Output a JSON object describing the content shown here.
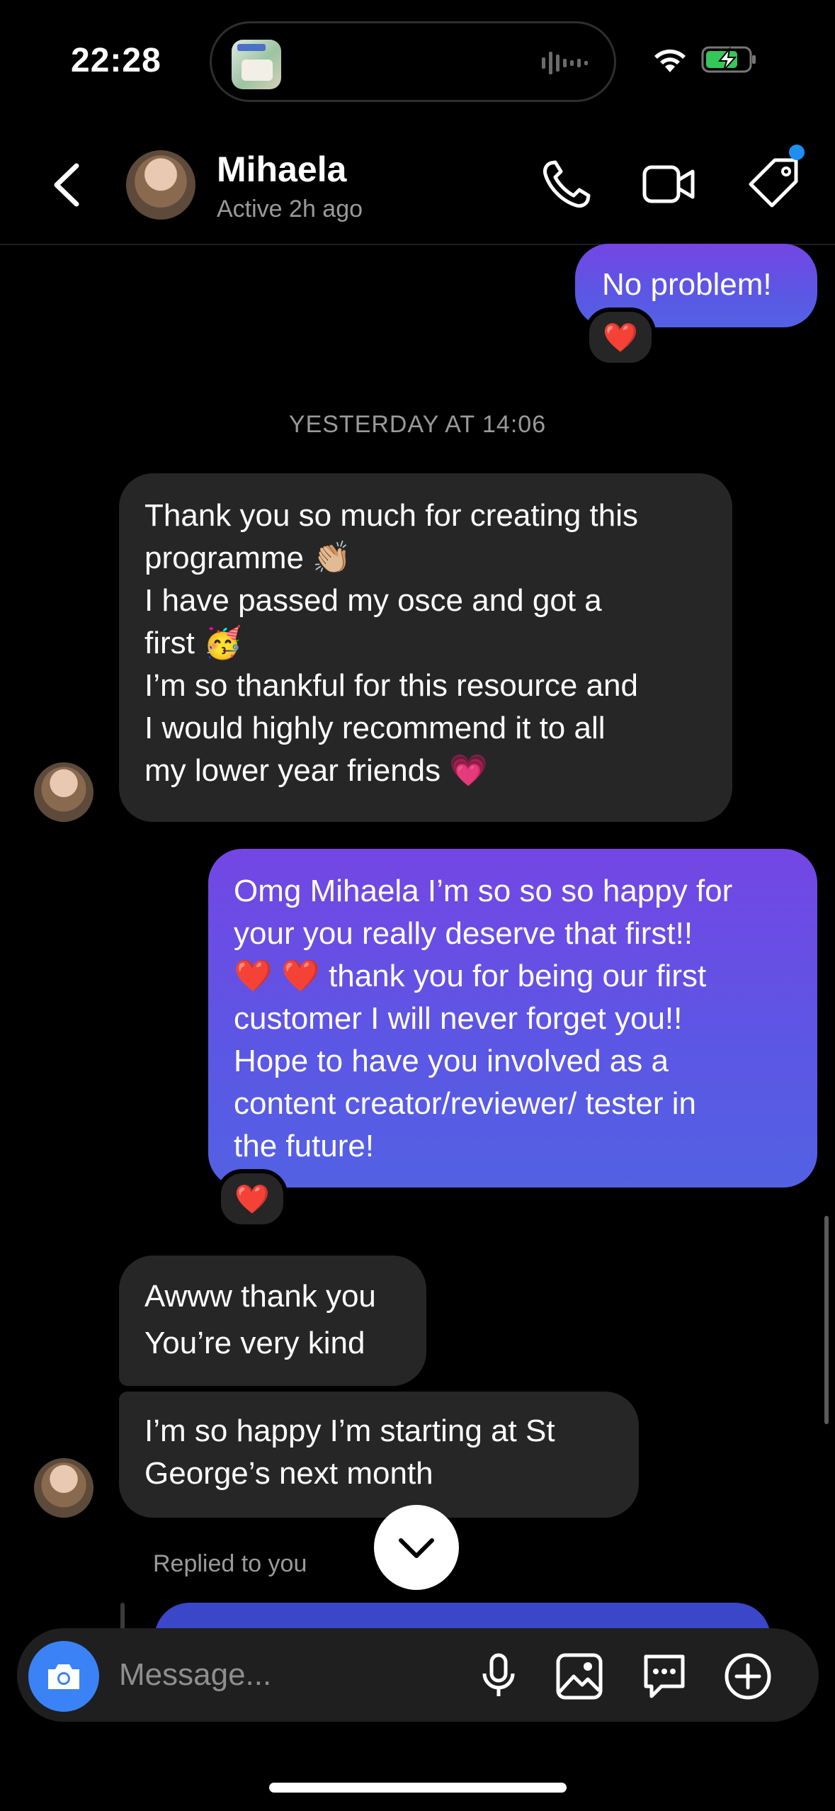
{
  "status_bar": {
    "time": "22:28"
  },
  "header": {
    "name": "Mihaela",
    "status": "Active 2h ago",
    "icons": [
      "back-chevron-icon",
      "phone-icon",
      "video-icon",
      "tag-icon"
    ]
  },
  "messages": {
    "m1": {
      "lines": [
        "No problem!"
      ],
      "reaction": "❤️"
    },
    "day_stamp": "YESTERDAY AT 14:06",
    "m2": {
      "lines": [
        "Thank you so much for creating this",
        "programme 👏🏼",
        "I have passed my osce and got a",
        "first 🥳",
        "I’m so thankful for this resource and",
        "I would highly recommend it to all",
        "my lower year friends 💗"
      ]
    },
    "m3": {
      "lines": [
        "Omg Mihaela I’m so so so happy for",
        "your you really deserve that first!!",
        "❤️ ❤️ thank you for being our first",
        "customer I will never forget you!!",
        "Hope to have you involved as a",
        "content creator/reviewer/ tester in",
        "the future!"
      ],
      "reaction": "❤️"
    },
    "m4": {
      "lines": [
        "Awww thank you",
        "You’re very kind"
      ]
    },
    "m5": {
      "lines": [
        "I’m so happy I’m starting at St",
        "George’s next month"
      ]
    },
    "replied_label": "Replied to you"
  },
  "composer": {
    "placeholder": "Message..."
  },
  "colors": {
    "accent": "#7446e3",
    "blue": "#3b82f6",
    "bubble_them": "#262626"
  }
}
